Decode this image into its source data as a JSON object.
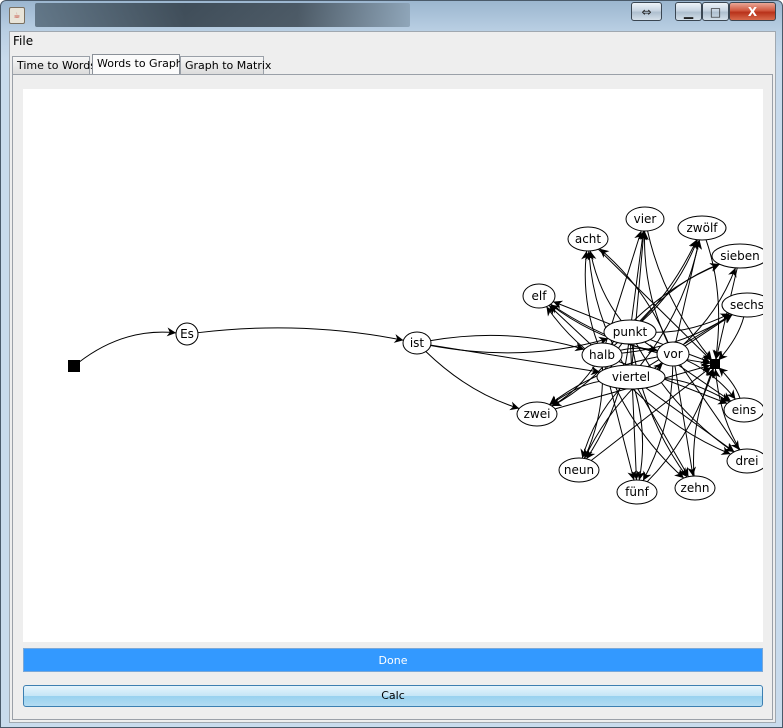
{
  "window": {
    "title": "",
    "buttons": {
      "resize": "⇔",
      "minimize": "▁",
      "maximize": "□",
      "close": "X"
    }
  },
  "menubar": {
    "file": "File"
  },
  "tabs": [
    {
      "label": "Time to Words",
      "selected": false
    },
    {
      "label": "Words to Graph",
      "selected": true
    },
    {
      "label": "Graph to Matrix",
      "selected": false
    }
  ],
  "graph": {
    "nodes": [
      {
        "id": "start",
        "label": "",
        "shape": "square"
      },
      {
        "id": "es",
        "label": "Es"
      },
      {
        "id": "ist",
        "label": "ist"
      },
      {
        "id": "acht",
        "label": "acht"
      },
      {
        "id": "vier",
        "label": "vier"
      },
      {
        "id": "zwoelf",
        "label": "zwölf"
      },
      {
        "id": "sieben",
        "label": "sieben"
      },
      {
        "id": "elf",
        "label": "elf"
      },
      {
        "id": "sechs",
        "label": "sechs"
      },
      {
        "id": "punkt",
        "label": "punkt"
      },
      {
        "id": "halb",
        "label": "halb"
      },
      {
        "id": "vor",
        "label": "vor"
      },
      {
        "id": "end",
        "label": "",
        "shape": "square"
      },
      {
        "id": "viertel",
        "label": "viertel"
      },
      {
        "id": "zwei",
        "label": "zwei"
      },
      {
        "id": "eins",
        "label": "eins"
      },
      {
        "id": "drei",
        "label": "drei"
      },
      {
        "id": "neun",
        "label": "neun"
      },
      {
        "id": "fuenf",
        "label": "fünf"
      },
      {
        "id": "zehn",
        "label": "zehn"
      }
    ],
    "edges": [
      [
        "start",
        "es"
      ],
      [
        "es",
        "ist"
      ],
      [
        "ist",
        "punkt"
      ],
      [
        "ist",
        "halb"
      ],
      [
        "ist",
        "viertel"
      ],
      [
        "ist",
        "zwei"
      ],
      [
        "punkt",
        "acht"
      ],
      [
        "punkt",
        "vier"
      ],
      [
        "punkt",
        "zwoelf"
      ],
      [
        "punkt",
        "sieben"
      ],
      [
        "punkt",
        "elf"
      ],
      [
        "punkt",
        "sechs"
      ],
      [
        "punkt",
        "zwei"
      ],
      [
        "punkt",
        "eins"
      ],
      [
        "punkt",
        "drei"
      ],
      [
        "punkt",
        "neun"
      ],
      [
        "punkt",
        "fuenf"
      ],
      [
        "punkt",
        "zehn"
      ],
      [
        "halb",
        "acht"
      ],
      [
        "halb",
        "vier"
      ],
      [
        "halb",
        "zwoelf"
      ],
      [
        "halb",
        "sieben"
      ],
      [
        "halb",
        "elf"
      ],
      [
        "halb",
        "sechs"
      ],
      [
        "halb",
        "zwei"
      ],
      [
        "halb",
        "eins"
      ],
      [
        "halb",
        "drei"
      ],
      [
        "halb",
        "neun"
      ],
      [
        "halb",
        "fuenf"
      ],
      [
        "halb",
        "zehn"
      ],
      [
        "viertel",
        "acht"
      ],
      [
        "viertel",
        "vier"
      ],
      [
        "viertel",
        "zwoelf"
      ],
      [
        "viertel",
        "elf"
      ],
      [
        "viertel",
        "sechs"
      ],
      [
        "viertel",
        "zwei"
      ],
      [
        "viertel",
        "eins"
      ],
      [
        "viertel",
        "drei"
      ],
      [
        "viertel",
        "neun"
      ],
      [
        "viertel",
        "fuenf"
      ],
      [
        "viertel",
        "zehn"
      ],
      [
        "vor",
        "acht"
      ],
      [
        "vor",
        "vier"
      ],
      [
        "vor",
        "zwoelf"
      ],
      [
        "vor",
        "sieben"
      ],
      [
        "vor",
        "elf"
      ],
      [
        "vor",
        "sechs"
      ],
      [
        "vor",
        "zwei"
      ],
      [
        "vor",
        "eins"
      ],
      [
        "vor",
        "drei"
      ],
      [
        "vor",
        "neun"
      ],
      [
        "vor",
        "fuenf"
      ],
      [
        "vor",
        "zehn"
      ],
      [
        "viertel",
        "vor"
      ],
      [
        "halb",
        "vor"
      ],
      [
        "acht",
        "end"
      ],
      [
        "vier",
        "end"
      ],
      [
        "zwoelf",
        "end"
      ],
      [
        "sieben",
        "end"
      ],
      [
        "elf",
        "end"
      ],
      [
        "sechs",
        "end"
      ],
      [
        "zwei",
        "end"
      ],
      [
        "eins",
        "end"
      ],
      [
        "drei",
        "end"
      ],
      [
        "neun",
        "end"
      ],
      [
        "fuenf",
        "end"
      ],
      [
        "zehn",
        "end"
      ],
      [
        "punkt",
        "end"
      ]
    ]
  },
  "buttons": {
    "done": "Done",
    "calc": "Calc"
  },
  "colors": {
    "done_bar": "#3399ff",
    "calc_button": "#b3dcf2"
  }
}
